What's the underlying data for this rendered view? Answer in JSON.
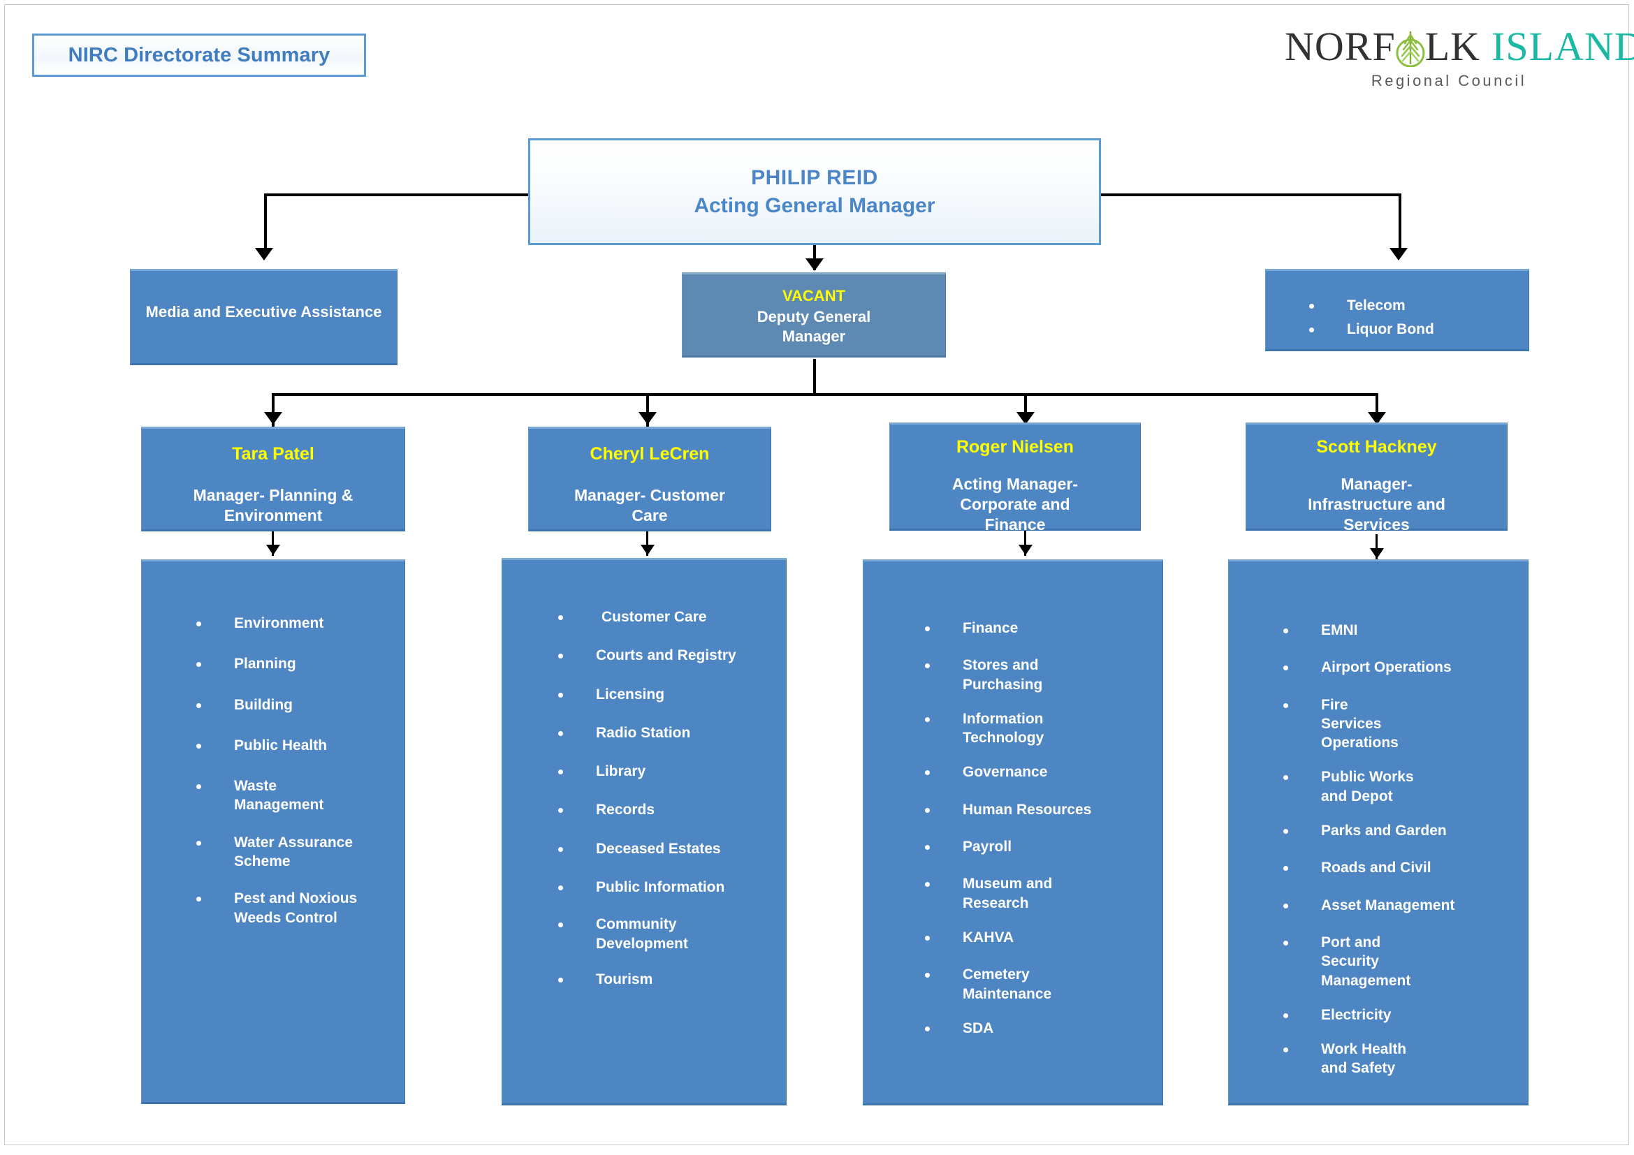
{
  "header": {
    "title_badge": "NIRC Directorate Summary",
    "logo": {
      "word1": "NORF",
      "tree_icon": "norfolk-pine-icon",
      "word2": "LK",
      "word3": "ISLAND",
      "subtitle": "Regional Council",
      "dark_color": "#323232",
      "teal_color": "#1bb9a3"
    }
  },
  "chart": {
    "top": {
      "name": "PHILIP REID",
      "title": "Acting General Manager"
    },
    "left_support": {
      "label": "Media and Executive Assistance"
    },
    "deputy": {
      "name": "VACANT",
      "title_line1": "Deputy General",
      "title_line2": "Manager",
      "name_color": "#ffff00"
    },
    "right_support": {
      "items": [
        "Telecom",
        "Liquor Bond"
      ]
    },
    "directorates": [
      {
        "name": "Tara Patel",
        "title_line1": "Manager- Planning &",
        "title_line2": "Environment",
        "functions": [
          "Environment",
          "Planning",
          "Building",
          "Public Health",
          "Waste Management",
          "Water Assurance Scheme",
          "Pest and Noxious Weeds Control"
        ]
      },
      {
        "name": "Cheryl LeCren",
        "title_line1": "Manager- Customer",
        "title_line2": "Care",
        "functions": [
          "Customer Care",
          "Courts and Registry",
          "Licensing",
          "Radio Station",
          "Library",
          "Records",
          "Deceased Estates",
          "Public Information",
          "Community Development",
          "Tourism"
        ]
      },
      {
        "name": "Roger Nielsen",
        "title_line1": "Acting Manager-",
        "title_line2": "Corporate and",
        "title_line3": "Finance",
        "functions": [
          "Finance",
          "Stores and Purchasing",
          "Information Technology",
          "Governance",
          "Human Resources",
          "Payroll",
          "Museum and Research",
          "KAHVA",
          "Cemetery Maintenance",
          "SDA"
        ]
      },
      {
        "name": "Scott Hackney",
        "title_line1": "Manager-",
        "title_line2": "Infrastructure and",
        "title_line3": "Services",
        "functions": [
          "EMNI",
          "Airport Operations",
          "Fire Services Operations",
          "Public Works and Depot",
          "Parks and Garden",
          "Roads and Civil",
          "Asset Management",
          "Port and Security Management",
          "Electricity",
          "Work Health and Safety"
        ]
      }
    ]
  },
  "colors": {
    "box_blue": "#4d86c2",
    "box_grey_blue": "#5d89b3",
    "accent_blue": "#4a86c8",
    "badge_border": "#5b9bd5",
    "highlight_yellow": "#ffff00"
  }
}
